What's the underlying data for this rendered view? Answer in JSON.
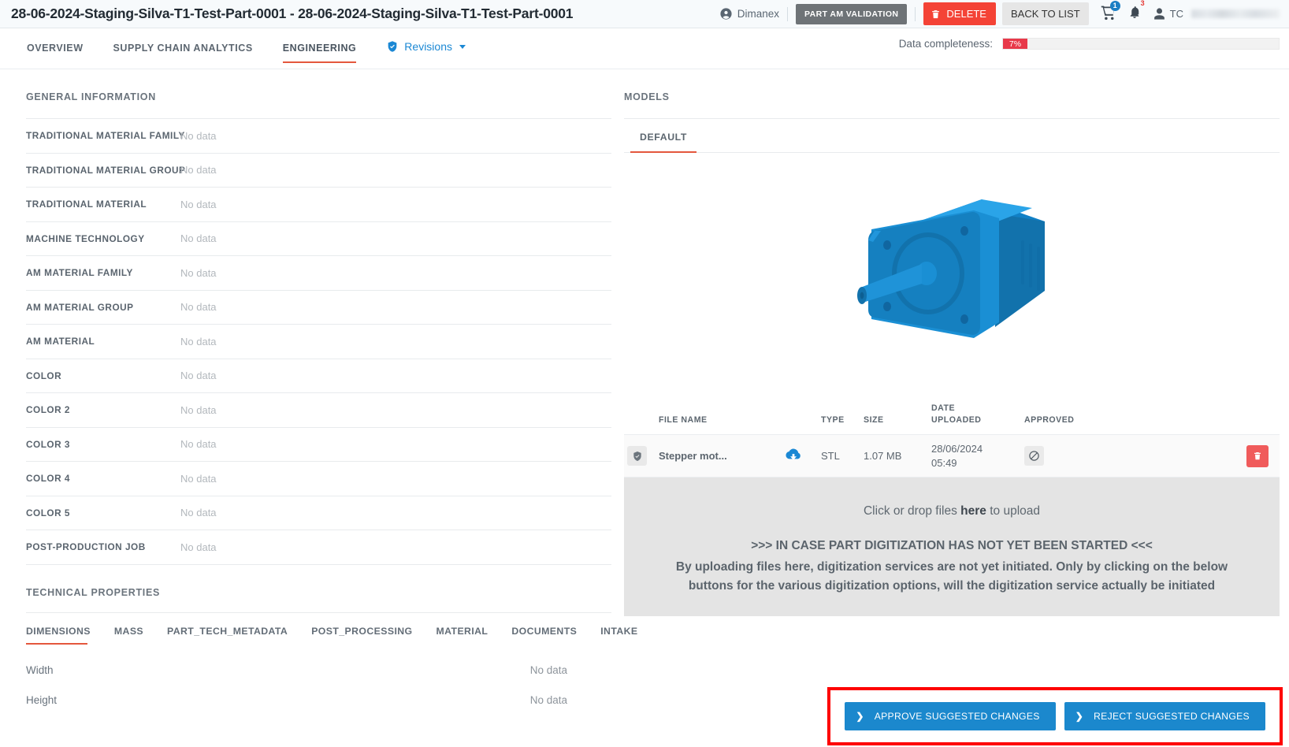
{
  "header": {
    "title": "28-06-2024-Staging-Silva-T1-Test-Part-0001 - 28-06-2024-Staging-Silva-T1-Test-Part-0001",
    "org_name": "Dimanex",
    "validation_badge": "PART AM VALIDATION",
    "delete_label": "DELETE",
    "back_label": "BACK TO LIST",
    "cart_count": "1",
    "notification_count": "3",
    "account_initials": "TC"
  },
  "nav": {
    "tabs": [
      {
        "label": "OVERVIEW",
        "active": false
      },
      {
        "label": "SUPPLY CHAIN ANALYTICS",
        "active": false
      },
      {
        "label": "ENGINEERING",
        "active": true
      }
    ],
    "revisions_label": "Revisions",
    "completeness_label": "Data completeness:",
    "completeness_value": "7%"
  },
  "general": {
    "section_title": "GENERAL INFORMATION",
    "rows": [
      {
        "label": "TRADITIONAL MATERIAL FAMILY",
        "value": "No data"
      },
      {
        "label": "TRADITIONAL MATERIAL GROUP",
        "value": "No data"
      },
      {
        "label": "TRADITIONAL MATERIAL",
        "value": "No data"
      },
      {
        "label": "MACHINE TECHNOLOGY",
        "value": "No data"
      },
      {
        "label": "AM MATERIAL FAMILY",
        "value": "No data"
      },
      {
        "label": "AM MATERIAL GROUP",
        "value": "No data"
      },
      {
        "label": "AM MATERIAL",
        "value": "No data"
      },
      {
        "label": "COLOR",
        "value": "No data"
      },
      {
        "label": "COLOR 2",
        "value": "No data"
      },
      {
        "label": "COLOR 3",
        "value": "No data"
      },
      {
        "label": "COLOR 4",
        "value": "No data"
      },
      {
        "label": "COLOR 5",
        "value": "No data"
      },
      {
        "label": "POST-PRODUCTION JOB",
        "value": "No data"
      }
    ]
  },
  "technical": {
    "section_title": "TECHNICAL PROPERTIES",
    "tabs": [
      {
        "label": "DIMENSIONS",
        "active": true
      },
      {
        "label": "MASS",
        "active": false
      },
      {
        "label": "PART_TECH_METADATA",
        "active": false
      },
      {
        "label": "POST_PROCESSING",
        "active": false
      },
      {
        "label": "MATERIAL",
        "active": false
      },
      {
        "label": "DOCUMENTS",
        "active": false
      },
      {
        "label": "INTAKE",
        "active": false
      }
    ],
    "properties": [
      {
        "label": "Width",
        "value": "No data"
      },
      {
        "label": "Height",
        "value": "No data"
      }
    ]
  },
  "models": {
    "section_title": "MODELS",
    "tabs": [
      {
        "label": "DEFAULT",
        "active": true
      }
    ],
    "viewer_model": "stepper-motor-3d-model",
    "table": {
      "columns": [
        "FILE NAME",
        "TYPE",
        "SIZE",
        "DATE UPLOADED",
        "APPROVED"
      ],
      "column_date_line1": "DATE",
      "column_date_line2": "UPLOADED",
      "rows": [
        {
          "file_name": "Stepper mot...",
          "type": "STL",
          "size": "1.07 MB",
          "date_line1": "28/06/2024",
          "date_line2": "05:49",
          "approved": "not-approved"
        }
      ]
    }
  },
  "dropzone": {
    "line1_prefix": "Click or drop files ",
    "line1_bold": "here",
    "line1_suffix": " to upload",
    "warn_title": ">>> IN CASE PART DIGITIZATION HAS NOT YET BEEN STARTED <<<",
    "warn_body": "By uploading files here, digitization services are not yet initiated. Only by clicking on the below buttons for the various digitization options, will the digitization service actually be initiated"
  },
  "actions": {
    "approve_label": "APPROVE SUGGESTED CHANGES",
    "reject_label": "REJECT SUGGESTED CHANGES",
    "chevron": "❯"
  },
  "colors": {
    "accent_red": "#e4573d",
    "danger": "#f44336",
    "primary_blue": "#1b88cd",
    "highlight_outline": "#fe0000",
    "completeness_bar": "#e8394a",
    "model_blue": "#1a8fd4"
  }
}
